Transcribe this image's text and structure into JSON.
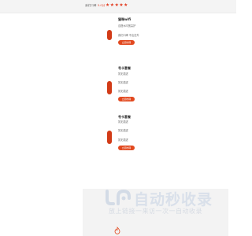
{
  "rating": {
    "label": "我们口碑",
    "score": "5.0分",
    "stars": "★★★★★",
    "star_color": "#e23a1e"
  },
  "cards": [
    {
      "title": "猫咪wifi",
      "lines": [
        "百搭水印宽高护",
        "我们口碑 不出意外"
      ],
      "button": "立即办理"
    },
    {
      "title": "号卡套餐",
      "lines": [
        "暂无描述",
        "暂无描述",
        "暂无描述"
      ],
      "button": "立即办理"
    },
    {
      "title": "号卡套餐",
      "lines": [
        "暂无描述",
        "暂无描述",
        "暂无描述"
      ],
      "button": "立即办理"
    }
  ],
  "watermark": {
    "title": "自动秒收录",
    "subtitle": "放上链接一来访一次一自动收录"
  },
  "colors": {
    "accent": "#e2491f",
    "panel_bg": "#f3f3f3"
  }
}
